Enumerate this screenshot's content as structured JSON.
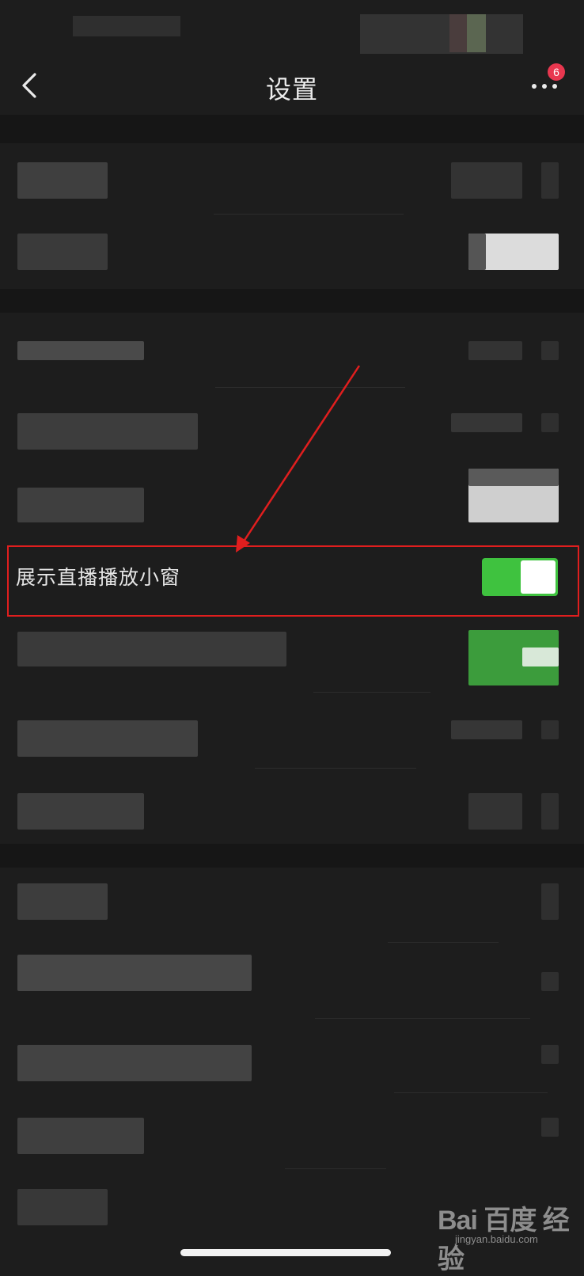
{
  "header": {
    "title": "设置",
    "back_icon": "chevron-left-icon",
    "more_icon": "more-dots-icon",
    "badge_count": "6"
  },
  "highlighted_setting": {
    "label": "展示直播播放小窗",
    "toggle_state": "on"
  },
  "colors": {
    "background": "#1d1d1d",
    "accent_toggle": "#3fc23f",
    "badge": "#e8374f",
    "annotation": "#e01e1e"
  },
  "watermark": {
    "logo": "Bai 百度 经验",
    "url": "jingyan.baidu.com"
  }
}
